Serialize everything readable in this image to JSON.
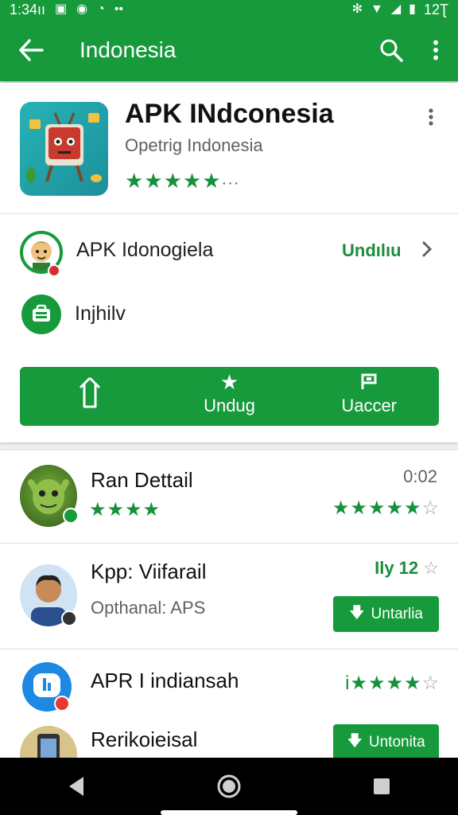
{
  "statusbar": {
    "time": "1:34ıı",
    "right_text": "12Ʈ"
  },
  "appbar": {
    "title": "Indonesia",
    "icons": [
      "back-arrow-icon",
      "search-icon",
      "more-vert-icon"
    ]
  },
  "app": {
    "title": "APK INdconesia",
    "subtitle": "Opetrig Indonesia",
    "stars": "★★★★★",
    "stars_suffix": "···"
  },
  "developer": {
    "name": "APK Idonogiela",
    "action": "Undılıu"
  },
  "info": {
    "label": "Injhilv"
  },
  "actions": [
    {
      "label": "",
      "icon": "share-icon"
    },
    {
      "label": "Undug",
      "icon": "star-icon"
    },
    {
      "label": "Uaccer",
      "icon": "flag-icon"
    }
  ],
  "items": [
    {
      "name": "Ran Dettail",
      "left_stars": "★★★★",
      "time": "0:02",
      "right_stars": "★★★★★",
      "right_empty": "☆"
    },
    {
      "name": "Kpp: Viifarail",
      "sub": "Opthanal: APS",
      "meta": "Ily 12",
      "meta_star": "☆",
      "button": "Untarlia"
    },
    {
      "name": "APR I indiansah",
      "right_prefix": "i",
      "right_stars": "★★★★",
      "right_empty": "☆"
    },
    {
      "name": "Rerikoieisal",
      "button": "Untonita"
    }
  ],
  "colors": {
    "accent": "#169a3b",
    "text": "#212121",
    "muted": "#616161"
  }
}
